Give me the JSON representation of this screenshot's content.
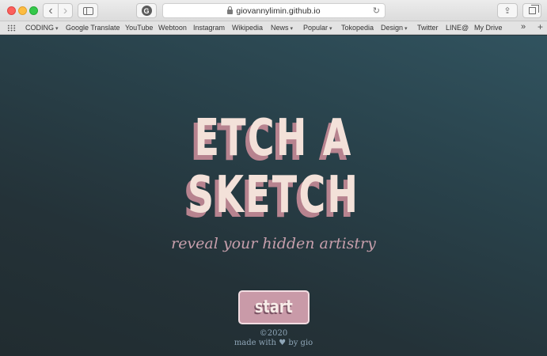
{
  "browser": {
    "url": "giovannylimin.github.io",
    "extension_icon": "G",
    "bookmarks": [
      {
        "label": "CODING",
        "dropdown": true
      },
      {
        "label": "Google Translate",
        "dropdown": false
      },
      {
        "label": "YouTube",
        "dropdown": false
      },
      {
        "label": "Webtoon",
        "dropdown": false
      },
      {
        "label": "Instagram",
        "dropdown": false
      },
      {
        "label": "Wikipedia",
        "dropdown": false
      },
      {
        "label": "News",
        "dropdown": true
      },
      {
        "label": "Popular",
        "dropdown": true
      },
      {
        "label": "Tokopedia",
        "dropdown": false
      },
      {
        "label": "Design",
        "dropdown": true
      },
      {
        "label": "Twitter",
        "dropdown": false
      },
      {
        "label": "LINE@",
        "dropdown": false
      },
      {
        "label": "My Drive",
        "dropdown": false
      }
    ]
  },
  "hero": {
    "title_line1": "ETCH A",
    "title_line2": "SKETCH",
    "tagline": "reveal your hidden artistry"
  },
  "start": {
    "label": "start"
  },
  "footer": {
    "copyright": "©2020",
    "made_with_prefix": "made with",
    "heart": "♥",
    "made_with_suffix": "by gio"
  },
  "colors": {
    "title": "#f3e1d9",
    "title_shadow": "#b7838f",
    "button": "#c99aa8",
    "tagline": "#c79fac"
  }
}
